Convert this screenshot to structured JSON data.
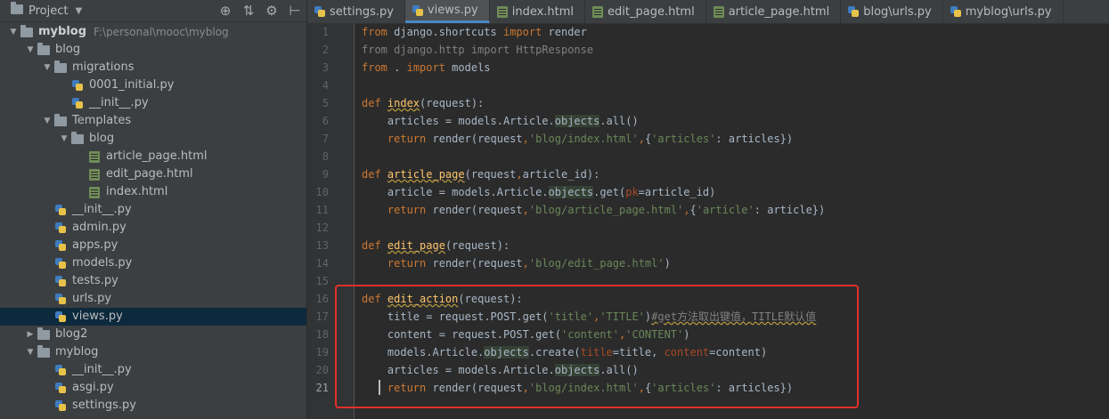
{
  "project": {
    "title": "Project",
    "tree": [
      {
        "label": "myblog",
        "path": "F:\\personal\\mooc\\myblog",
        "type": "folder",
        "level": 0,
        "arrow": "down",
        "bold": true
      },
      {
        "label": "blog",
        "type": "folder",
        "level": 1,
        "arrow": "down"
      },
      {
        "label": "migrations",
        "type": "folder",
        "level": 2,
        "arrow": "down"
      },
      {
        "label": "0001_initial.py",
        "type": "py",
        "level": 3,
        "arrow": "none"
      },
      {
        "label": "__init__.py",
        "type": "py",
        "level": 3,
        "arrow": "none"
      },
      {
        "label": "Templates",
        "type": "folder",
        "level": 2,
        "arrow": "down"
      },
      {
        "label": "blog",
        "type": "folder",
        "level": 3,
        "arrow": "down"
      },
      {
        "label": "article_page.html",
        "type": "html",
        "level": 4,
        "arrow": "none"
      },
      {
        "label": "edit_page.html",
        "type": "html",
        "level": 4,
        "arrow": "none"
      },
      {
        "label": "index.html",
        "type": "html",
        "level": 4,
        "arrow": "none"
      },
      {
        "label": "__init__.py",
        "type": "py",
        "level": 2,
        "arrow": "none"
      },
      {
        "label": "admin.py",
        "type": "py",
        "level": 2,
        "arrow": "none"
      },
      {
        "label": "apps.py",
        "type": "py",
        "level": 2,
        "arrow": "none"
      },
      {
        "label": "models.py",
        "type": "py",
        "level": 2,
        "arrow": "none"
      },
      {
        "label": "tests.py",
        "type": "py",
        "level": 2,
        "arrow": "none"
      },
      {
        "label": "urls.py",
        "type": "py",
        "level": 2,
        "arrow": "none"
      },
      {
        "label": "views.py",
        "type": "py",
        "level": 2,
        "arrow": "none",
        "selected": true
      },
      {
        "label": "blog2",
        "type": "folder",
        "level": 1,
        "arrow": "right"
      },
      {
        "label": "myblog",
        "type": "folder",
        "level": 1,
        "arrow": "down"
      },
      {
        "label": "__init__.py",
        "type": "py",
        "level": 2,
        "arrow": "none"
      },
      {
        "label": "asgi.py",
        "type": "py",
        "level": 2,
        "arrow": "none"
      },
      {
        "label": "settings.py",
        "type": "py",
        "level": 2,
        "arrow": "none"
      }
    ]
  },
  "tabs": [
    {
      "label": "settings.py",
      "type": "py"
    },
    {
      "label": "views.py",
      "type": "py",
      "active": true
    },
    {
      "label": "index.html",
      "type": "html"
    },
    {
      "label": "edit_page.html",
      "type": "html"
    },
    {
      "label": "article_page.html",
      "type": "html"
    },
    {
      "label": "blog\\urls.py",
      "type": "py"
    },
    {
      "label": "myblog\\urls.py",
      "type": "py"
    }
  ],
  "editor": {
    "current_line": 21,
    "lines": [
      [
        [
          "kw",
          "from"
        ],
        [
          "t",
          " django.shortcuts "
        ],
        [
          "kw",
          "import"
        ],
        [
          "t",
          " render"
        ]
      ],
      [
        [
          "unused",
          "from django.http import HttpResponse"
        ]
      ],
      [
        [
          "kw",
          "from"
        ],
        [
          "t",
          " . "
        ],
        [
          "kw",
          "import"
        ],
        [
          "t",
          " models"
        ]
      ],
      [],
      [
        [
          "kw",
          "def "
        ],
        [
          "fnw",
          "index"
        ],
        [
          "t",
          "(request):"
        ]
      ],
      [
        [
          "t",
          "    articles = models.Article."
        ],
        [
          "hl",
          "objects"
        ],
        [
          "t",
          ".all()"
        ]
      ],
      [
        [
          "t",
          "    "
        ],
        [
          "kw",
          "return"
        ],
        [
          "t",
          " render(request"
        ],
        [
          "kw",
          ","
        ],
        [
          "str",
          "'blog/index.html'"
        ],
        [
          "kw",
          ","
        ],
        [
          "t",
          "{"
        ],
        [
          "str",
          "'articles'"
        ],
        [
          "t",
          ": articles})"
        ]
      ],
      [],
      [
        [
          "kw",
          "def "
        ],
        [
          "fnw",
          "article_page"
        ],
        [
          "t",
          "(request"
        ],
        [
          "kw",
          ","
        ],
        [
          "t",
          "article_id):"
        ]
      ],
      [
        [
          "t",
          "    article = models.Article."
        ],
        [
          "hl",
          "objects"
        ],
        [
          "t",
          ".get("
        ],
        [
          "par",
          "pk"
        ],
        [
          "t",
          "=article_id)"
        ]
      ],
      [
        [
          "t",
          "    "
        ],
        [
          "kw",
          "return"
        ],
        [
          "t",
          " render(request"
        ],
        [
          "kw",
          ","
        ],
        [
          "str",
          "'blog/article_page.html'"
        ],
        [
          "kw",
          ","
        ],
        [
          "t",
          "{"
        ],
        [
          "str",
          "'article'"
        ],
        [
          "t",
          ": article})"
        ]
      ],
      [],
      [
        [
          "kw",
          "def "
        ],
        [
          "fnw",
          "edit_page"
        ],
        [
          "t",
          "(request):"
        ]
      ],
      [
        [
          "t",
          "    "
        ],
        [
          "kw",
          "return"
        ],
        [
          "t",
          " render(request"
        ],
        [
          "kw",
          ","
        ],
        [
          "str",
          "'blog/edit_page.html'"
        ],
        [
          "t",
          ")"
        ]
      ],
      [],
      [
        [
          "kw",
          "def "
        ],
        [
          "fnw",
          "edit_action"
        ],
        [
          "t",
          "(request):"
        ]
      ],
      [
        [
          "t",
          "    title = request.POST.get("
        ],
        [
          "str",
          "'title'"
        ],
        [
          "kw",
          ","
        ],
        [
          "str",
          "'TITLE'"
        ],
        [
          "t",
          ")"
        ],
        [
          "cmw",
          "#get方法取出键值，TITLE默认值"
        ]
      ],
      [
        [
          "t",
          "    content = request.POST.get("
        ],
        [
          "str",
          "'content'"
        ],
        [
          "kw",
          ","
        ],
        [
          "str",
          "'CONTENT'"
        ],
        [
          "t",
          ")"
        ]
      ],
      [
        [
          "t",
          "    models.Article."
        ],
        [
          "hl",
          "objects"
        ],
        [
          "t",
          ".create("
        ],
        [
          "par",
          "title"
        ],
        [
          "t",
          "=title, "
        ],
        [
          "par",
          "content"
        ],
        [
          "t",
          "=content)"
        ]
      ],
      [
        [
          "t",
          "    articles = models.Article."
        ],
        [
          "hl",
          "objects"
        ],
        [
          "t",
          ".all()"
        ]
      ],
      [
        [
          "t",
          "    "
        ],
        [
          "kw",
          "return"
        ],
        [
          "t",
          " render(request"
        ],
        [
          "kw",
          ","
        ],
        [
          "str",
          "'blog/index.html'"
        ],
        [
          "kw",
          ","
        ],
        [
          "t",
          "{"
        ],
        [
          "str",
          "'articles'"
        ],
        [
          "t",
          ": articles})"
        ]
      ]
    ]
  },
  "colors": {
    "keyword": "#cc7832",
    "function": "#ffc66d",
    "string": "#6a8759",
    "param": "#aa4926",
    "highlight_box": "#e0302a"
  }
}
